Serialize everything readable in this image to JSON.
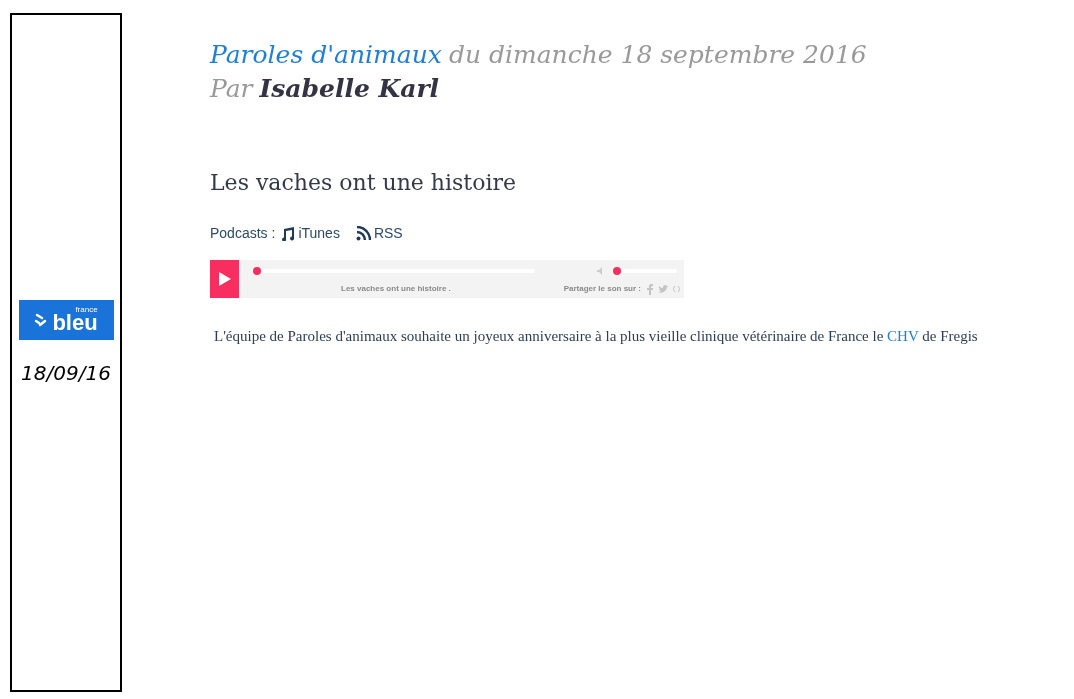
{
  "sidebar": {
    "logo": {
      "small": "france",
      "big": "bleu"
    },
    "date": "18/09/16"
  },
  "header": {
    "show_link": "Paroles d'animaux",
    "date_line": "du dimanche 18 septembre 2016",
    "by": "Par",
    "author": "Isabelle Karl"
  },
  "title": "Les vaches ont une histoire",
  "podcasts": {
    "label": "Podcasts :",
    "links": [
      {
        "kind": "itunes",
        "label": "iTunes"
      },
      {
        "kind": "rss",
        "label": "RSS"
      }
    ]
  },
  "player": {
    "track": "Les vaches ont une histoire .",
    "progress": {
      "level": 0
    },
    "volume": {
      "level": 0
    },
    "share_label": "Partager le son sur :"
  },
  "paragraph": {
    "before": "L'équipe de Paroles d'animaux souhaite un joyeux anniversaire à la plus vieille clinique vétérinaire de France le",
    "link": "CHV",
    "after": "de Fregis"
  }
}
